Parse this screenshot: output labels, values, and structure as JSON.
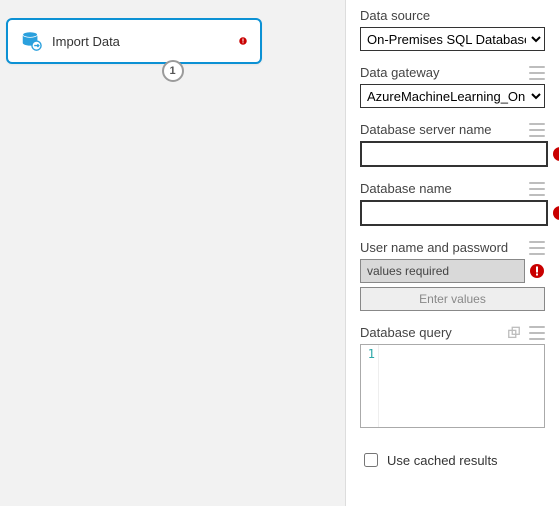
{
  "canvas": {
    "module": {
      "title": "Import Data",
      "icon": "database-import-icon",
      "has_error": true,
      "output_port_index": "1"
    }
  },
  "form": {
    "data_source": {
      "label": "Data source",
      "selected": "On-Premises SQL Database"
    },
    "data_gateway": {
      "label": "Data gateway",
      "selected": "AzureMachineLearning_OnPrem"
    },
    "db_server_name": {
      "label": "Database server name",
      "value": "",
      "has_error": true
    },
    "db_name": {
      "label": "Database name",
      "value": "",
      "has_error": true
    },
    "credentials": {
      "label": "User name and password",
      "display": "values required",
      "button": "Enter values",
      "has_error": true
    },
    "db_query": {
      "label": "Database query",
      "line_number": "1",
      "value": ""
    },
    "use_cached": {
      "label": "Use cached results",
      "checked": false
    }
  }
}
